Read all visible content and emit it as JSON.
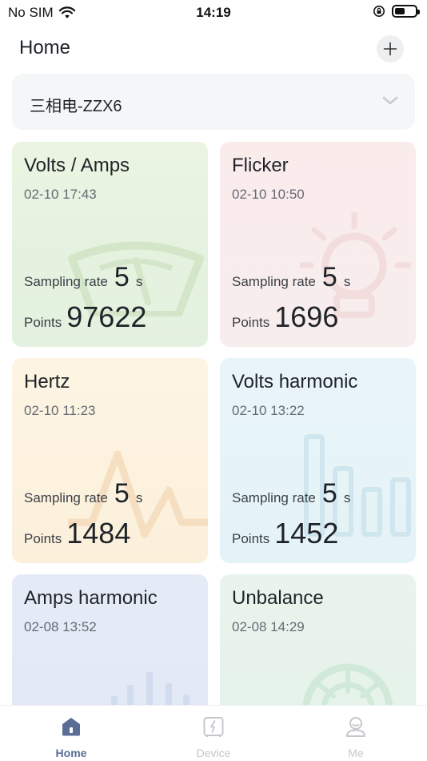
{
  "status_bar": {
    "carrier": "No SIM",
    "time": "14:19"
  },
  "header": {
    "title": "Home"
  },
  "device_selector": {
    "selected": "三相电-ZZX6"
  },
  "cards": [
    {
      "title": "Volts / Amps",
      "date": "02-10 17:43",
      "rate_label": "Sampling rate",
      "rate_value": "5",
      "rate_unit": "s",
      "points_label": "Points",
      "points_value": "97622",
      "color": "#e6f2df"
    },
    {
      "title": "Flicker",
      "date": "02-10 10:50",
      "rate_label": "Sampling rate",
      "rate_value": "5",
      "rate_unit": "s",
      "points_label": "Points",
      "points_value": "1696",
      "color": "#f9ecec"
    },
    {
      "title": "Hertz",
      "date": "02-10 11:23",
      "rate_label": "Sampling rate",
      "rate_value": "5",
      "rate_unit": "s",
      "points_label": "Points",
      "points_value": "1484",
      "color": "#fcf2de"
    },
    {
      "title": "Volts harmonic",
      "date": "02-10 13:22",
      "rate_label": "Sampling rate",
      "rate_value": "5",
      "rate_unit": "s",
      "points_label": "Points",
      "points_value": "1452",
      "color": "#e6f3f7"
    },
    {
      "title": "Amps harmonic",
      "date": "02-08 13:52",
      "color": "#e3e9f5"
    },
    {
      "title": "Unbalance",
      "date": "02-08 14:29",
      "color": "#e6f3ea"
    }
  ],
  "tabs": [
    {
      "label": "Home",
      "icon": "home-icon",
      "active": true
    },
    {
      "label": "Device",
      "icon": "device-icon",
      "active": false
    },
    {
      "label": "Me",
      "icon": "user-icon",
      "active": false
    }
  ],
  "colors": {
    "accent": "#5a6e95",
    "tab_inactive": "#c4c7cc"
  }
}
